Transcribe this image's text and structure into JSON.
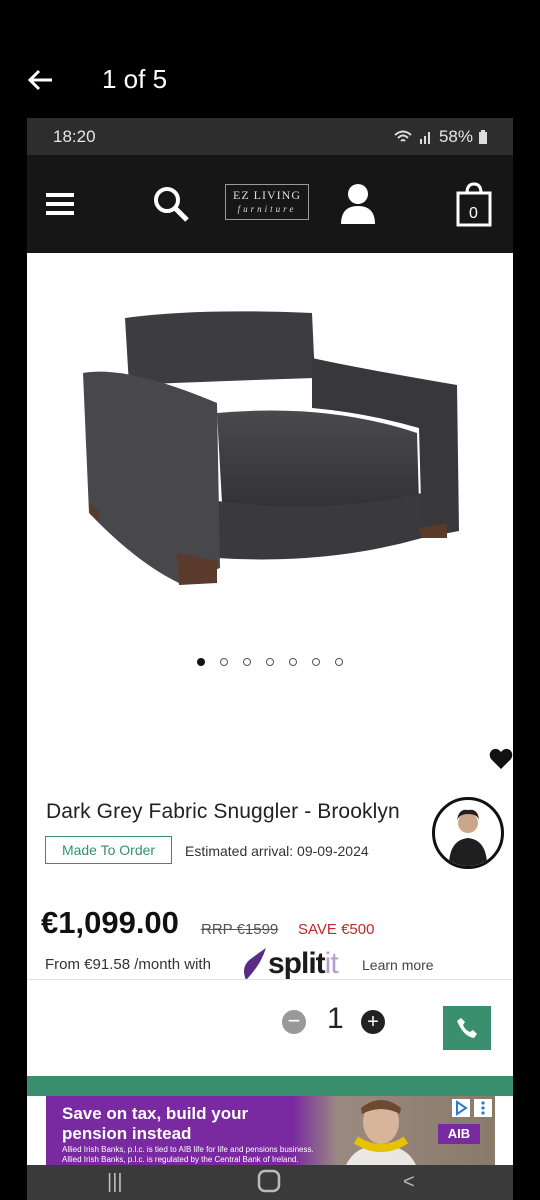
{
  "viewer": {
    "counter": "1 of 5",
    "back_icon": "arrow-left-icon"
  },
  "status_bar": {
    "time": "18:20",
    "battery": "58%"
  },
  "header": {
    "icons": [
      "menu-icon",
      "search-icon",
      "user-icon",
      "cart-icon"
    ],
    "logo_line1": "EZ LIVING",
    "logo_line2": "furniture",
    "cart_count": "0"
  },
  "gallery": {
    "total": 7,
    "active_index": 0
  },
  "product": {
    "title": "Dark Grey Fabric Snuggler - Brooklyn",
    "badge": "Made To Order",
    "arrival": "Estimated arrival: 09-09-2024",
    "price": "€1,099.00",
    "rrp": "RRP €1599",
    "save": "SAVE €500",
    "finance": "From €91.58 /month with",
    "splitit_word": "split",
    "splitit_it": "it",
    "learn_more": "Learn more",
    "quantity": "1"
  },
  "ad": {
    "headline1": "Save on tax, build your",
    "headline2": "pension instead",
    "small1": "Allied Irish Banks, p.l.c. is tied to AIB life for life and pensions business.",
    "small2": "Allied Irish Banks, p.l.c. is regulated by the Central Bank of Ireland.",
    "brand": "AIB"
  },
  "colors": {
    "accent": "#3a8f6e",
    "save_red": "#c2262e",
    "header_bg": "#161616",
    "ad_purple": "#7a2aa0"
  }
}
